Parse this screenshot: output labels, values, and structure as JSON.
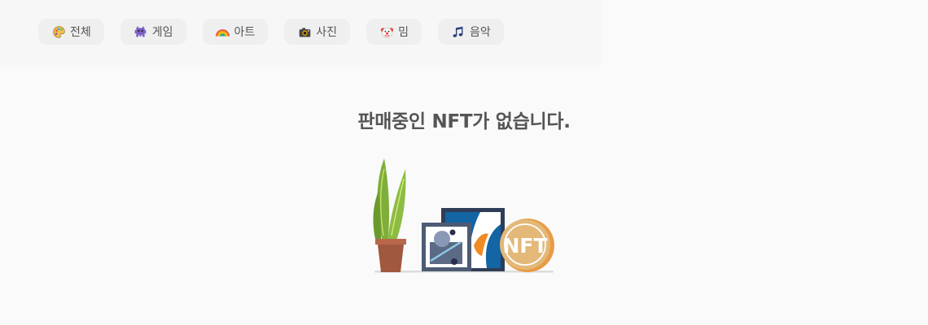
{
  "categories": [
    {
      "icon": "palette-icon",
      "label": "전체"
    },
    {
      "icon": "alien-monster-icon",
      "label": "게임"
    },
    {
      "icon": "rainbow-icon",
      "label": "아트"
    },
    {
      "icon": "camera-icon",
      "label": "사진"
    },
    {
      "icon": "clown-face-icon",
      "label": "밈"
    },
    {
      "icon": "music-notes-icon",
      "label": "음악"
    }
  ],
  "empty_state": {
    "message": "판매중인 NFT가 없습니다.",
    "coin_label": "NFT"
  },
  "colors": {
    "chip_bg": "#efefef",
    "coin_gold": "#e3b878",
    "frame_dark": "#2f3d56",
    "pot_brown": "#a0583f",
    "leaf_green": "#7fae3a"
  }
}
